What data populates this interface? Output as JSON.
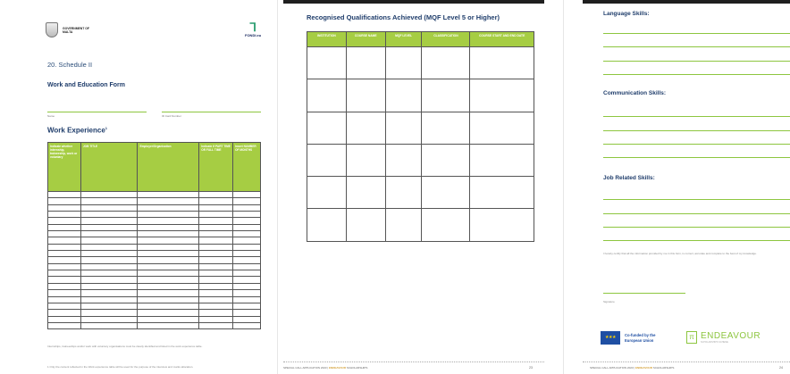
{
  "page1": {
    "logo_left_text": "GOVERNMENT OF MALTA",
    "logo_right_text": "FONDI.eu",
    "schedule": "20. Schedule II",
    "form_title": "Work and Education Form",
    "name_label": "Name",
    "id_label": "ID Card Number",
    "work_experience_title": "Work Experience",
    "work_experience_footnote_mark": "1",
    "work_table": {
      "headers": [
        "Indicate whether internship, traineeship, work or voluntary",
        "JOB TITLE",
        "Employer/Organisation",
        "Indicate if PART TIME OR FULL TIME",
        "Insert NUMBER OF MONTHS"
      ],
      "row_count": 21
    },
    "footnote_1": "Internships, traineeships and/or work with voluntary organisations must be clearly identified and listed in the work experience table.",
    "footnote_2": "1 Only the content reflected in the Work experience table will be used for the purpose of the interview and marks allocation."
  },
  "page2": {
    "title": "Recognised Qualifications Achieved (MQF Level 5 or Higher)",
    "qual_table": {
      "headers": [
        "INSTITUTION",
        "COURSE NAME",
        "MQF LEVEL",
        "CLASSIFICATION",
        "COURSE START AND END DATE"
      ],
      "row_count": 6
    },
    "footer_left": "SPECIAL CALL APPLICATION 2023",
    "footer_brand": "ENDEAVOUR",
    "footer_right": "SCHOLARSHIPS",
    "page_number": "23"
  },
  "page3": {
    "language_title": "Language Skills:",
    "communication_title": "Communication Skills:",
    "job_title": "Job Related Skills:",
    "certification": "I hereby certify that all the information provided by me in this form, is correct, accurate and complete to the best of my knowledge.",
    "signature_label": "Signature",
    "eu_text": "Co-funded by the European Union",
    "endeavour_text": "ENDEAVOUR",
    "endeavour_sub": "SCHOLARSHIPS SCHEME",
    "footer_left": "SPECIAL CALL APPLICATION 2023",
    "footer_brand": "ENDEAVOUR",
    "footer_right": "SCHOLARSHIPS",
    "page_number": "24"
  },
  "colors": {
    "accent_green": "#a6cd43",
    "line_green": "#8dc63f",
    "title_navy": "#1f3d6b"
  }
}
